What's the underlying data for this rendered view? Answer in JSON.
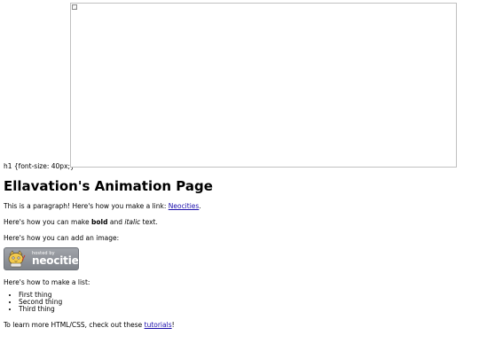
{
  "top": {
    "caption": "h1 {font-size: 40px;}"
  },
  "heading": {
    "title": "Ellavation's Animation Page"
  },
  "paragraph_1": {
    "prefix": "This is a paragraph! Here's how you make a link: ",
    "link_label": "Neocities",
    "suffix": "."
  },
  "paragraph_2": {
    "prefix": "Here's how you can make ",
    "bold": "bold",
    "middle": " and ",
    "italic": "italic",
    "suffix": " text."
  },
  "paragraph_3": {
    "text": "Here's how you can add an image:"
  },
  "badge": {
    "hosted_text": "hosted by",
    "brand_text": "neocities"
  },
  "paragraph_4": {
    "text": "Here's how to make a list:"
  },
  "list": {
    "items": [
      "First thing",
      "Second thing",
      "Third thing"
    ]
  },
  "paragraph_5": {
    "prefix": "To learn more HTML/CSS, check out these ",
    "link_label": "tutorials",
    "suffix": "!"
  },
  "colors": {
    "link": "#1a0dab",
    "badge_background": "#8e9198"
  },
  "icons": {
    "broken_image": "broken-image-icon",
    "badge_logo": "neocities-cat-logo"
  }
}
